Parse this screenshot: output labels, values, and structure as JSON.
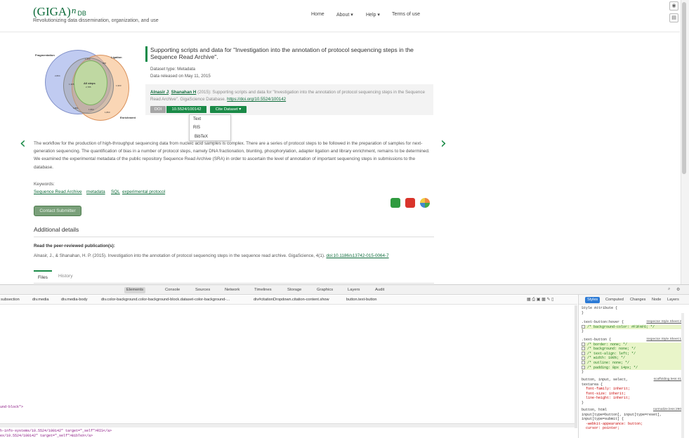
{
  "header": {
    "logo_main": "(GIGA)",
    "logo_sup": "n",
    "logo_db": "DB",
    "tagline": "Revolutionizing data dissemination, organization, and use",
    "nav": [
      "Home",
      "About ▾",
      "Help ▾",
      "Terms of use"
    ]
  },
  "side_buttons": [
    "eye-icon",
    "note-icon"
  ],
  "venn": {
    "labels": [
      "Fragmentation",
      "Ligation",
      "Enrichment"
    ],
    "center": "All steps",
    "numbers": [
      "2,804",
      "1,200",
      "506",
      "1,881",
      "1,953",
      "1,863",
      "2,785",
      "1,305",
      "1,903"
    ]
  },
  "dataset": {
    "title": "Supporting scripts and data for \"Investigation into the annotation of protocol sequencing steps in the Sequence Read Archive\".",
    "type": "Dataset type: Metadata",
    "released": "Data released on May 11, 2015",
    "author1": "Alnasir J",
    "author_sep": "; ",
    "author2": "Shanahan H",
    "citation": " (2015): Supporting scripts and data for \"Investigation into the annotation of protocol sequencing steps in the Sequence Read Archive\". GigaScience Database. ",
    "citation_link": "https://doi.org/10.5524/100142",
    "doi_label": "DOI",
    "doi_value": "10.5524/100142",
    "cite_button": "Cite Dataset ▾",
    "cite_menu": [
      "Text",
      "RIS",
      "BibTeX"
    ]
  },
  "description": "The workflow for the production of high-throughput sequencing data from nucleic acid samples is complex. There are a series of protocol steps to be followed in the preparation of samples for next-generation sequencing. The quantification of bias in a number of protocol steps, namely DNA fractionation, blunting, phosphorylation, adapter ligation and library enrichment, remains to be determined. We examined the experimental metadata of the public repository Sequence Read Archive (SRA) in order to ascertain the level of annotation of important sequencing steps in submissions to the database.",
  "keywords": {
    "label": "Keywords:",
    "items": [
      "Sequence Read Archive",
      "metadata",
      "SQL",
      "experimental protocol"
    ]
  },
  "contact_button": "Contact Submitter",
  "share_icons": [
    "share-icon-green",
    "share-icon-red",
    "share-icon-multicolor"
  ],
  "additional": {
    "heading": "Additional details",
    "peer_heading": "Read the peer-reviewed publication(s):",
    "peer_ref": "Alnasir, J., & Shanahan, H. P. (2015). Investigation into the annotation of protocol sequencing steps in the sequence read archive. GigaScience, 4(1). ",
    "peer_link": "doi:10.1186/s13742-015-0064-7"
  },
  "tabs": [
    "Files",
    "History"
  ],
  "devtools": {
    "tabs": [
      "Elements",
      "Console",
      "Sources",
      "Network",
      "Timelines",
      "Storage",
      "Graphics",
      "Layers",
      "Audit"
    ],
    "breadcrumbs": [
      "subsection",
      "div.media",
      "div.media-body",
      "div.color-background.color-background-block.dataset-color-background-…",
      "div#citationDropdown.citation-content.show",
      "button.text-button"
    ],
    "code_lines": [
      "und-block\">",
      "h-info-systems/10.5524/100142\" target=\"_self\">RIS</a>",
      "ex/10.5524/100142\" target=\"_self\">BibTeX</a>"
    ],
    "right_tabs": [
      "Styles",
      "Computed",
      "Changes",
      "Node",
      "Layers"
    ],
    "style_attr": "Style Attribute {",
    "style_attr_close": "}",
    "rule1_sel": ".text-button:hover {",
    "rule1_src": "Inspector Style Sheet:2",
    "rule1_props": [
      "/* background-color: #F3FAF6; */"
    ],
    "rule2_sel": ".text-button {",
    "rule2_src": "Inspector Style Sheet:1",
    "rule2_props": [
      "/* border: none; */",
      "/* background: none; */",
      "/* text-align: left; */",
      "/* width: 100%; */",
      "/* outline: none; */",
      "/* padding: 8px 14px; */"
    ],
    "rule3_sel": "button, input, select,",
    "rule3_sel2": "textarea {",
    "rule3_src": "scaffolding.less:41",
    "rule3_props": [
      "font-family: inherit;",
      "font-size: inherit;",
      "line-height: inherit;"
    ],
    "rule4_sel": "button, html",
    "rule4_sel2": "input[type=button], input[type=reset],",
    "rule4_sel3": "input[type=submit] {",
    "rule4_src": "normalize.less:290",
    "rule4_props": [
      "-webkit-appearance: button;",
      "cursor: pointer;"
    ],
    "brace": "}"
  }
}
